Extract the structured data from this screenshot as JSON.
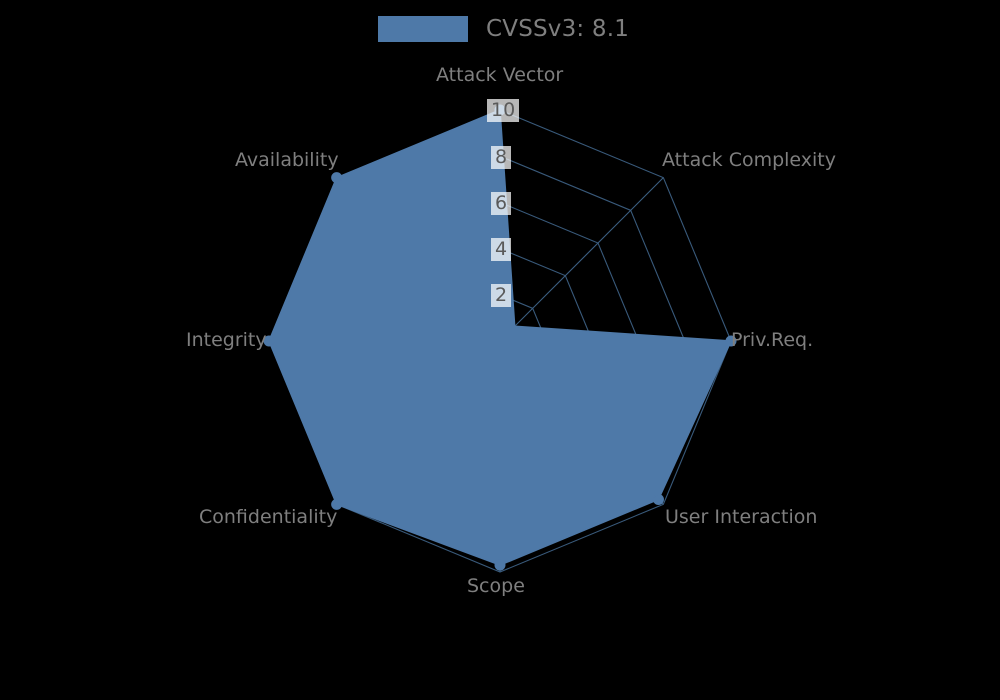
{
  "chart_data": {
    "type": "radar",
    "title": "",
    "legend": [
      {
        "label": "CVSSv3: 8.1",
        "color": "#4e79a8"
      }
    ],
    "legend_position": "top-center",
    "categories": [
      "Attack Vector",
      "Attack Complexity",
      "Priv.Req.",
      "User Interaction",
      "Scope",
      "Confidentiality",
      "Integrity",
      "Availability"
    ],
    "series": [
      {
        "name": "CVSSv3: 8.1",
        "color": "#4e79a8",
        "values": [
          10,
          0.9,
          10,
          9.7,
          9.7,
          10,
          10,
          10
        ]
      }
    ],
    "radial_ticks": [
      "2",
      "4",
      "6",
      "8",
      "10"
    ],
    "radial_tick_values": [
      2,
      4,
      6,
      8,
      10
    ],
    "rlim": [
      0,
      10
    ],
    "grid": true,
    "background_color": "#000000",
    "label_color": "#7f7f7f",
    "grid_color": "#3c5f82"
  },
  "axis_labels": {
    "attack_vector": "Attack Vector",
    "attack_complexity": "Attack Complexity",
    "priv_req": "Priv.Req.",
    "user_interaction": "User Interaction",
    "scope": "Scope",
    "confidentiality": "Confidentiality",
    "integrity": "Integrity",
    "availability": "Availability"
  },
  "ticks": {
    "t2": "2",
    "t4": "4",
    "t6": "6",
    "t8": "8",
    "t10": "10"
  },
  "legend": {
    "series_label": "CVSSv3: 8.1"
  }
}
